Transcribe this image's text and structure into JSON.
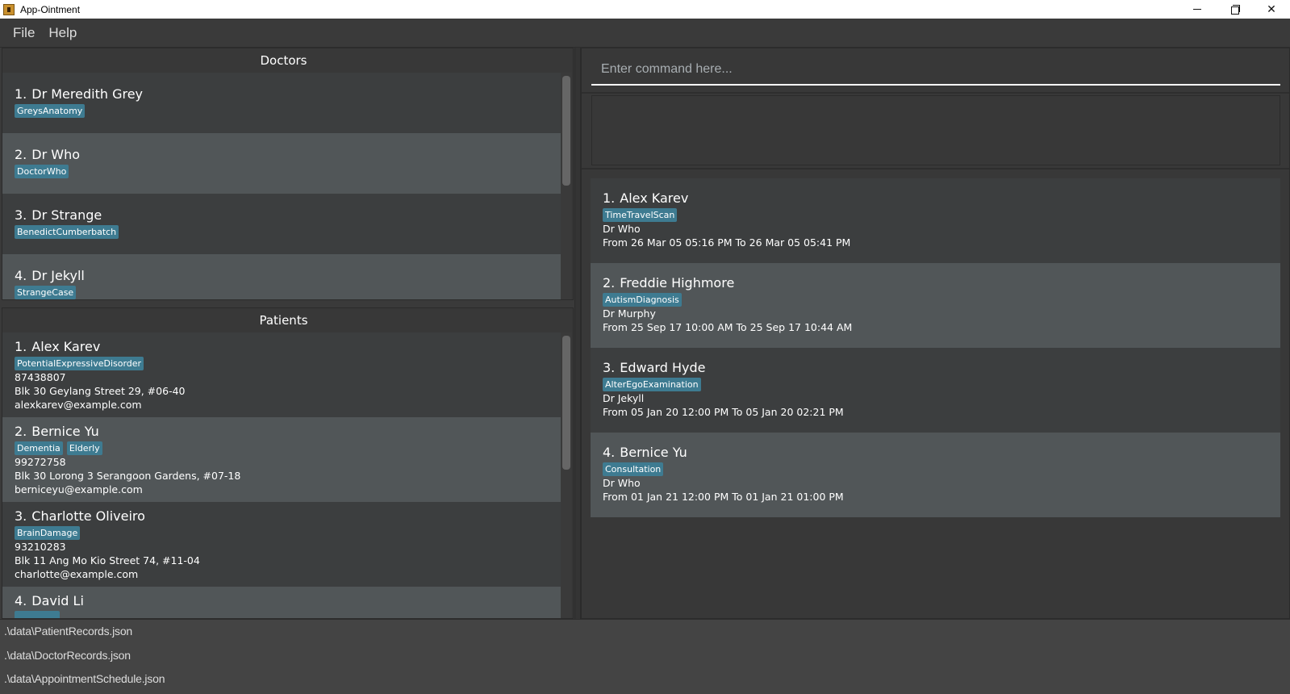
{
  "window": {
    "title": "App-Ointment",
    "controls": {
      "minimize": "minimize-icon",
      "maximize": "restore-icon",
      "close": "close-icon"
    }
  },
  "menu": {
    "items": [
      "File",
      "Help"
    ]
  },
  "doctors": {
    "header": "Doctors",
    "items": [
      {
        "index": "1.",
        "name": "Dr Meredith Grey",
        "tags": [
          "GreysAnatomy"
        ]
      },
      {
        "index": "2.",
        "name": "Dr Who",
        "tags": [
          "DoctorWho"
        ]
      },
      {
        "index": "3.",
        "name": "Dr Strange",
        "tags": [
          "BenedictCumberbatch"
        ]
      },
      {
        "index": "4.",
        "name": "Dr Jekyll",
        "tags": [
          "StrangeCase"
        ]
      }
    ]
  },
  "patients": {
    "header": "Patients",
    "items": [
      {
        "index": "1.",
        "name": "Alex Karev",
        "tags": [
          "PotentialExpressiveDisorder"
        ],
        "phone": "87438807",
        "address": "Blk 30 Geylang Street 29, #06-40",
        "email": "alexkarev@example.com"
      },
      {
        "index": "2.",
        "name": "Bernice Yu",
        "tags": [
          "Dementia",
          "Elderly"
        ],
        "phone": "99272758",
        "address": "Blk 30 Lorong 3 Serangoon Gardens, #07-18",
        "email": "berniceyu@example.com"
      },
      {
        "index": "3.",
        "name": "Charlotte Oliveiro",
        "tags": [
          "BrainDamage"
        ],
        "phone": "93210283",
        "address": "Blk 11 Ang Mo Kio Street 74, #11-04",
        "email": "charlotte@example.com"
      },
      {
        "index": "4.",
        "name": "David Li",
        "tags": [
          ""
        ],
        "phone": "",
        "address": "",
        "email": ""
      }
    ]
  },
  "command": {
    "placeholder": "Enter command here...",
    "value": ""
  },
  "result_display": {
    "text": ""
  },
  "appointments": {
    "items": [
      {
        "index": "1.",
        "patient": "Alex Karev",
        "tags": [
          "TimeTravelScan"
        ],
        "doctor": "Dr Who",
        "time": "From 26 Mar 05 05:16 PM To 26 Mar 05 05:41 PM"
      },
      {
        "index": "2.",
        "patient": "Freddie Highmore",
        "tags": [
          "AutismDiagnosis"
        ],
        "doctor": "Dr Murphy",
        "time": "From 25 Sep 17 10:00 AM To 25 Sep 17 10:44 AM"
      },
      {
        "index": "3.",
        "patient": "Edward Hyde",
        "tags": [
          "AlterEgoExamination"
        ],
        "doctor": "Dr Jekyll",
        "time": "From 05 Jan 20 12:00 PM To 05 Jan 20 02:21 PM"
      },
      {
        "index": "4.",
        "patient": "Bernice Yu",
        "tags": [
          "Consultation"
        ],
        "doctor": "Dr Who",
        "time": "From 01 Jan 21 12:00 PM To 01 Jan 21 01:00 PM"
      }
    ]
  },
  "status_bar": {
    "paths": [
      ".\\data\\PatientRecords.json",
      ".\\data\\DoctorRecords.json",
      ".\\data\\AppointmentSchedule.json"
    ]
  },
  "colors": {
    "tag": "#3e7b91",
    "row_odd": "#3c3e3f",
    "row_even": "#515658",
    "background": "#383838"
  }
}
